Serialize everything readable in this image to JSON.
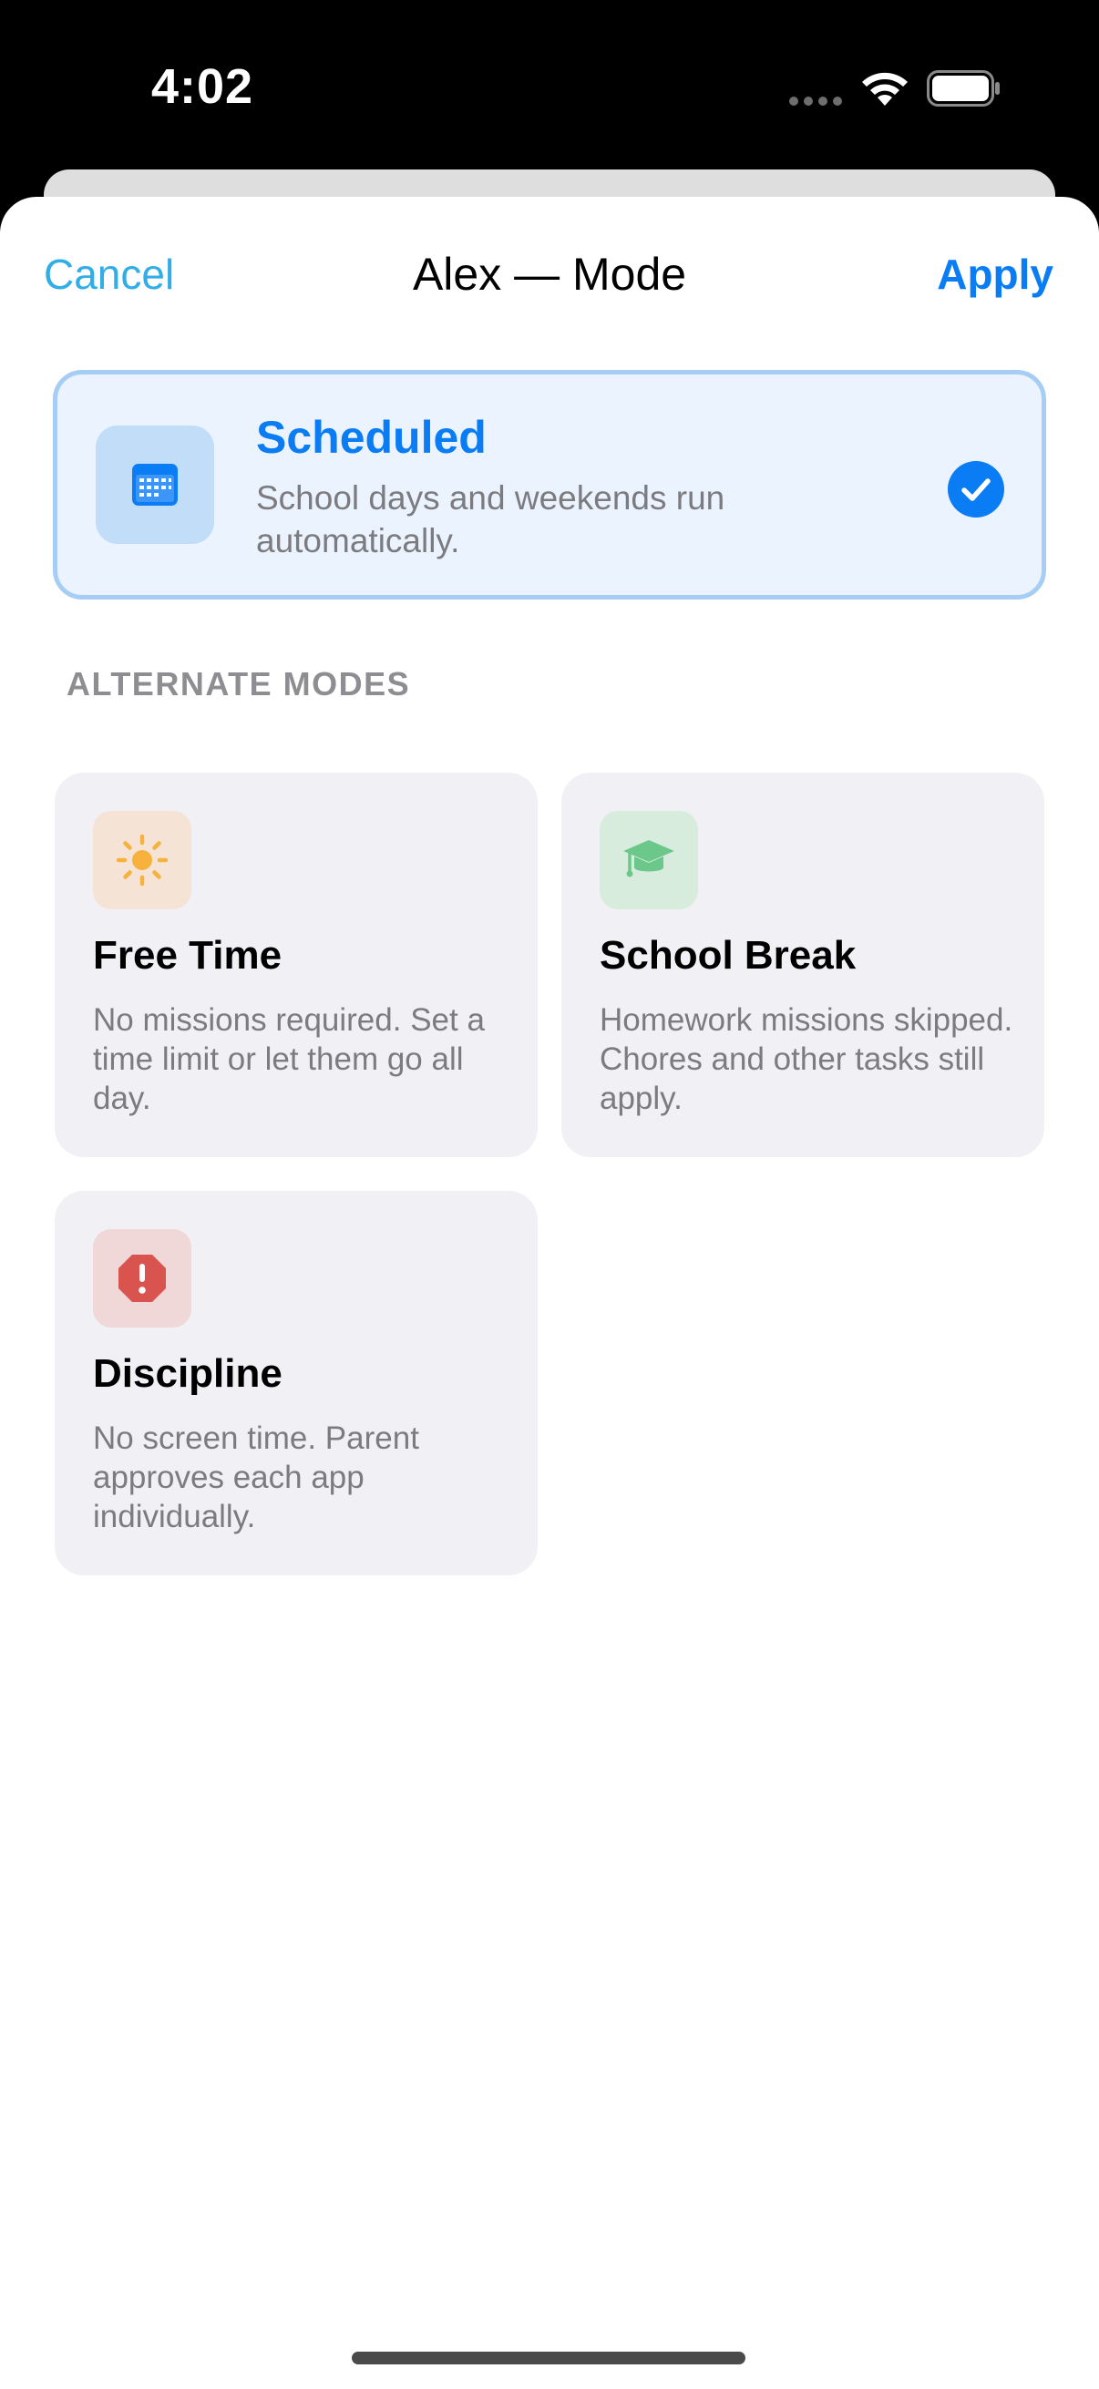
{
  "status_bar": {
    "time": "4:02"
  },
  "nav": {
    "cancel_label": "Cancel",
    "title": "Alex — Mode",
    "apply_label": "Apply"
  },
  "selected_mode": {
    "title": "Scheduled",
    "description": "School days and weekends run automatically.",
    "icon": "calendar-icon",
    "selected": true,
    "accent_color": "#0a7cf4"
  },
  "alternate_modes": {
    "section_label": "ALTERNATE MODES",
    "items": [
      {
        "title": "Free Time",
        "description": "No missions required. Set a time limit or let them go all day.",
        "icon": "sun-icon",
        "color": "#f6b23c"
      },
      {
        "title": "School Break",
        "description": "Homework missions skipped. Chores and other tasks still apply.",
        "icon": "graduation-cap-icon",
        "color": "#6cc88a"
      },
      {
        "title": "Discipline",
        "description": "No screen time. Parent approves each app individually.",
        "icon": "stop-alert-icon",
        "color": "#d9534f"
      }
    ]
  }
}
